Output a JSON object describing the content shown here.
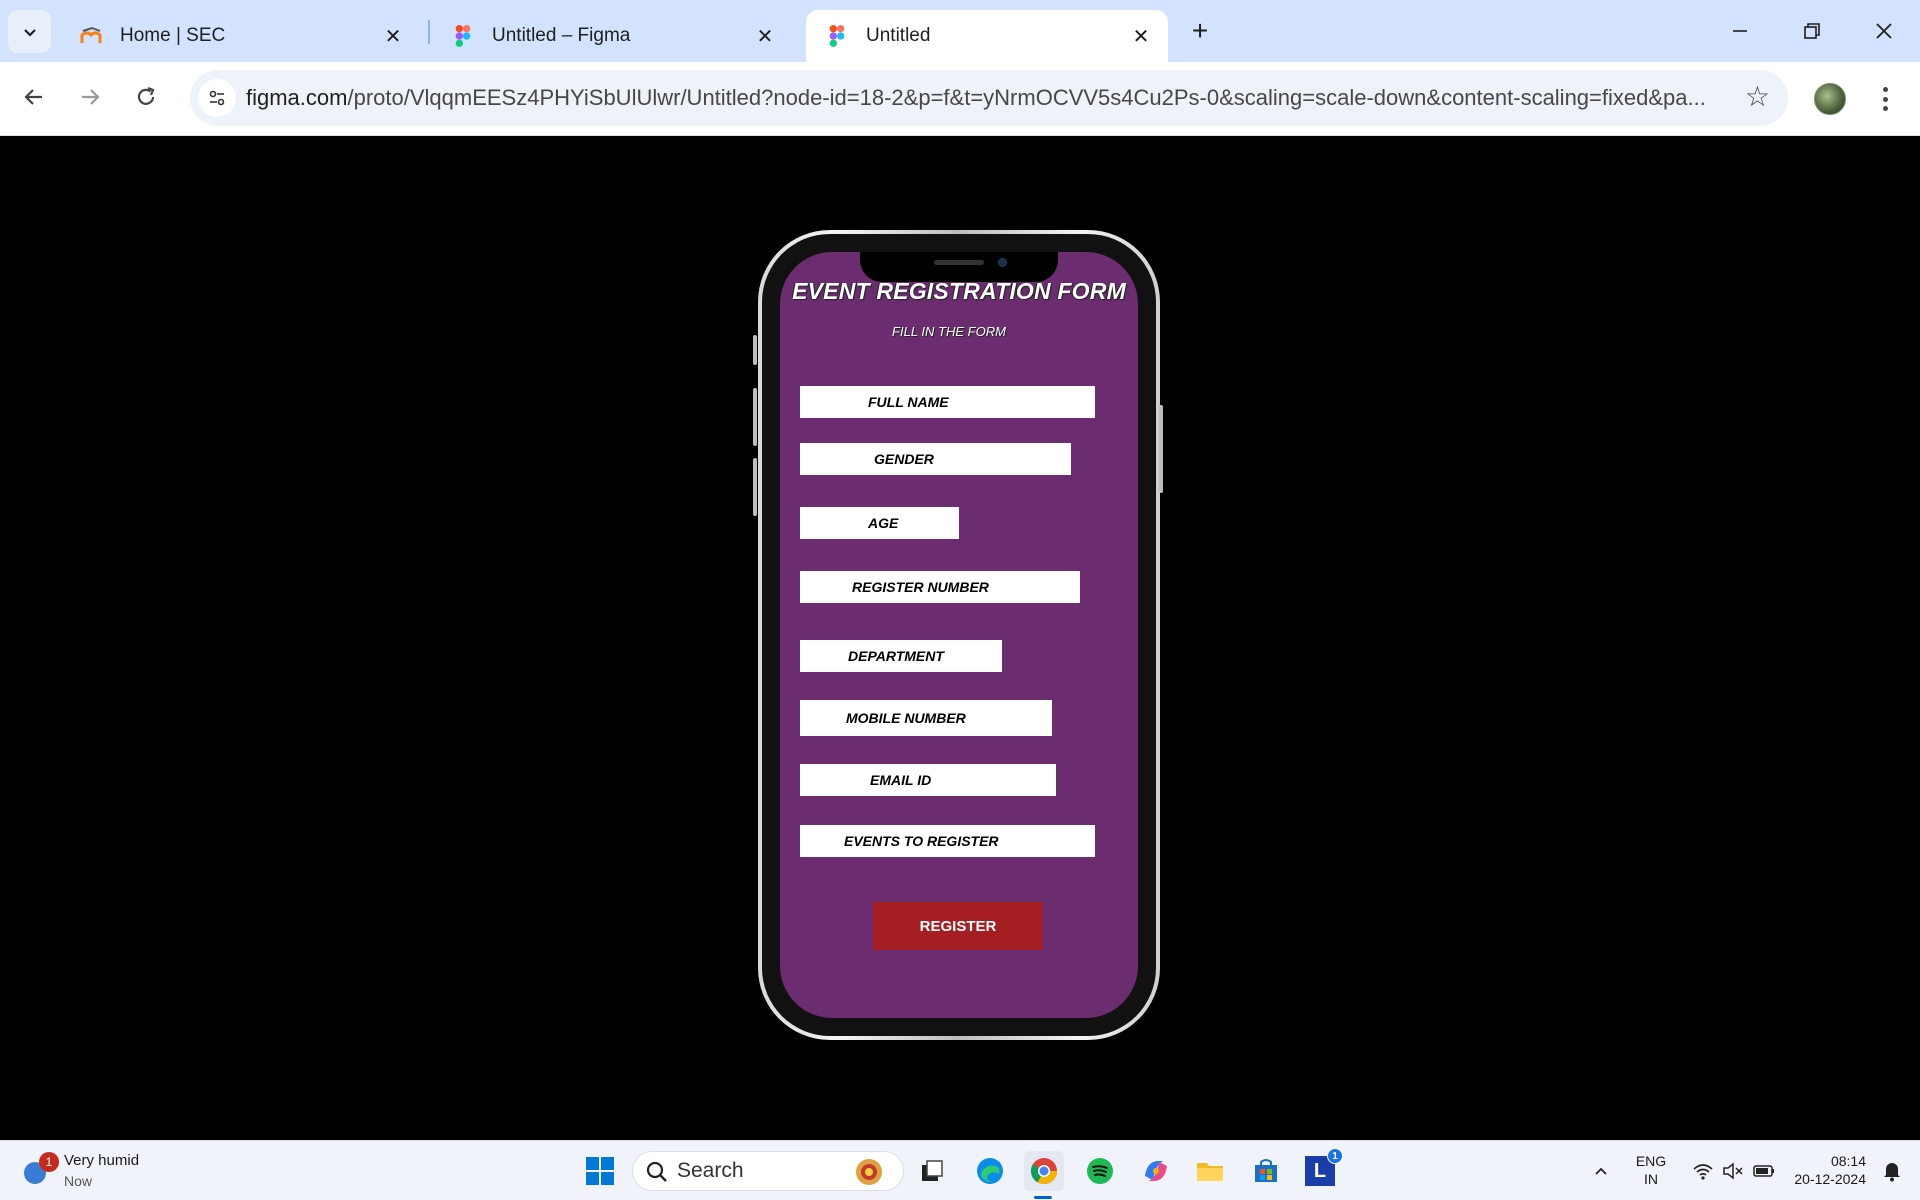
{
  "browser": {
    "tabs": [
      {
        "title": "Home | SEC",
        "icon": "moodle-icon",
        "active": false
      },
      {
        "title": "Untitled – Figma",
        "icon": "figma-icon",
        "active": false
      },
      {
        "title": "Untitled",
        "icon": "figma-icon",
        "active": true
      }
    ],
    "url_host": "figma.com",
    "url_rest": "/proto/VlqqmEESz4PHYiSbUlUlwr/Untitled?node-id=18-2&p=f&t=yNrmOCVV5s4Cu2Ps-0&scaling=scale-down&content-scaling=fixed&pa..."
  },
  "form": {
    "title": "EVENT REGISTRATION FORM",
    "subtitle": "FILL IN THE FORM",
    "fields": [
      {
        "label": "FULL NAME"
      },
      {
        "label": "GENDER"
      },
      {
        "label": "AGE"
      },
      {
        "label": "REGISTER NUMBER"
      },
      {
        "label": "DEPARTMENT"
      },
      {
        "label": "MOBILE NUMBER"
      },
      {
        "label": "EMAIL ID"
      },
      {
        "label": "EVENTS TO REGISTER"
      }
    ],
    "submit_label": "REGISTER",
    "colors": {
      "background": "#6b2c70",
      "button": "#a51f22",
      "field": "#ffffff"
    }
  },
  "taskbar": {
    "weather": {
      "condition": "Very humid",
      "time": "Now",
      "badge": "1"
    },
    "search_placeholder": "Search",
    "lang_top": "ENG",
    "lang_bottom": "IN",
    "clock_time": "08:14",
    "clock_date": "20-12-2024",
    "app_badge": "1"
  }
}
